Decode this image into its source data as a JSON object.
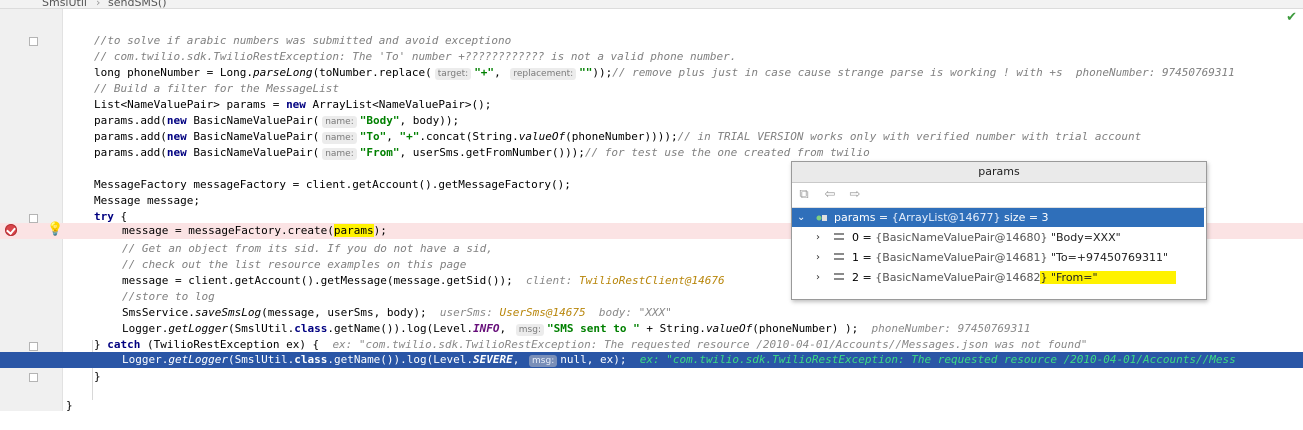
{
  "breadcrumb": {
    "file": "SmslUtil",
    "method": "sendSMS()"
  },
  "code": {
    "l1": "//to solve if arabic numbers was submitted and avoid exceptiono",
    "l2": "// com.twilio.sdk.TwilioRestException: The 'To' number +???????????? is not a valid phone number.",
    "l3a": "long phoneNumber = Long.",
    "l3b": "parseLong",
    "l3c": "(toNumber.replace(",
    "l3h1": "target:",
    "l3d": "\"+\"",
    "l3e": ", ",
    "l3h2": "replacement:",
    "l3f": "\"\"",
    "l3g": "));",
    "l3cm": "// remove plus just in case cause strange parse is working ! with +s  phoneNumber: 97450769311",
    "l4": "// Build a filter for the MessageList",
    "l5a": "List<NameValuePair> params = ",
    "l5kw": "new",
    "l5b": " ArrayList<NameValuePair>();",
    "l6a": "params.add(",
    "l6kw": "new",
    "l6b": " BasicNameValuePair(",
    "l6h": "name:",
    "l6s": "\"Body\"",
    "l6c": ", body));",
    "l7a": "params.add(",
    "l7kw": "new",
    "l7b": " BasicNameValuePair(",
    "l7h": "name:",
    "l7s1": "\"To\"",
    "l7c": ", ",
    "l7s2": "\"+\"",
    "l7d": ".concat(String.",
    "l7it": "valueOf",
    "l7e": "(phoneNumber))));",
    "l7cm": "// in TRIAL VERSION works only with verified number with trial account",
    "l8a": "params.add(",
    "l8kw": "new",
    "l8b": " BasicNameValuePair(",
    "l8h": "name:",
    "l8s": "\"From\"",
    "l8c": ", userSms.getFromNumber()));",
    "l8cm": "// for test use the one created from twilio",
    "l9": "MessageFactory messageFactory = client.getAccount().getMessageFactory();",
    "l10": "Message message;",
    "l11kw": "try",
    "l11": " {",
    "l12a": "message = messageFactory.create(",
    "l12p": "params",
    "l12b": ");",
    "l13": "// Get an object from its sid. If you do not have a sid,",
    "l14": "// check out the list resource examples on this page",
    "l15a": "message = client.getAccount().getMessage(message.getSid());",
    "l15d": "client: ",
    "l15v": "TwilioRestClient@14676",
    "l16": "//store to log",
    "l17a": "SmsService.",
    "l17it": "saveSmsLog",
    "l17b": "(message, userSms, body);",
    "l17d1": "userSms: ",
    "l17v1": "UserSms@14675",
    "l17d2": "body: \"XXX\"",
    "l18a": "Logger.",
    "l18it": "getLogger",
    "l18b": "(SmslUtil.",
    "l18kw": "class",
    "l18c": ".getName()).log(Level.",
    "l18cst": "INFO",
    "l18d": ", ",
    "l18h": "msg:",
    "l18s": "\"SMS sent to \"",
    "l18e": " + String.",
    "l18it2": "valueOf",
    "l18f": "(phoneNumber) );",
    "l18dbg": "phoneNumber: 97450769311",
    "l19a": "} ",
    "l19kw": "catch",
    "l19b": " (TwilioRestException ex) {",
    "l19dbg": "ex: \"com.twilio.sdk.TwilioRestException: The requested resource /2010-04-01/Accounts//Messages.json was not found\"",
    "l20a": "Logger.",
    "l20it": "getLogger",
    "l20b": "(SmslUtil.",
    "l20kw": "class",
    "l20c": ".getName()).log(Level.",
    "l20cst": "SEVERE",
    "l20d": ", ",
    "l20h": "msg:",
    "l20e": "null, ex);",
    "l20dbg": "ex: \"com.twilio.sdk.TwilioRestException: The requested resource /2010-04-01/Accounts//Mess",
    "l21": "}",
    "l22": "}"
  },
  "popup": {
    "title": "params",
    "root": {
      "name": "params",
      "eq": " = ",
      "type": "{ArrayList@14677}",
      "size": " size = 3"
    },
    "items": [
      {
        "index": "0",
        "eq": " = ",
        "type": "{BasicNameValuePair@14680}",
        "value": " \"Body=XXX\""
      },
      {
        "index": "1",
        "eq": " = ",
        "type": "{BasicNameValuePair@14681}",
        "value": " \"To=+97450769311\""
      },
      {
        "index": "2",
        "eq": " = ",
        "type": "{BasicNameValuePair@14682",
        "value": "} \"From=\""
      }
    ]
  },
  "colors": {
    "breakpoint": "#d9454a",
    "execution_line": "#2a56a6",
    "selection": "#2f6fba",
    "highlight": "#fff200"
  }
}
